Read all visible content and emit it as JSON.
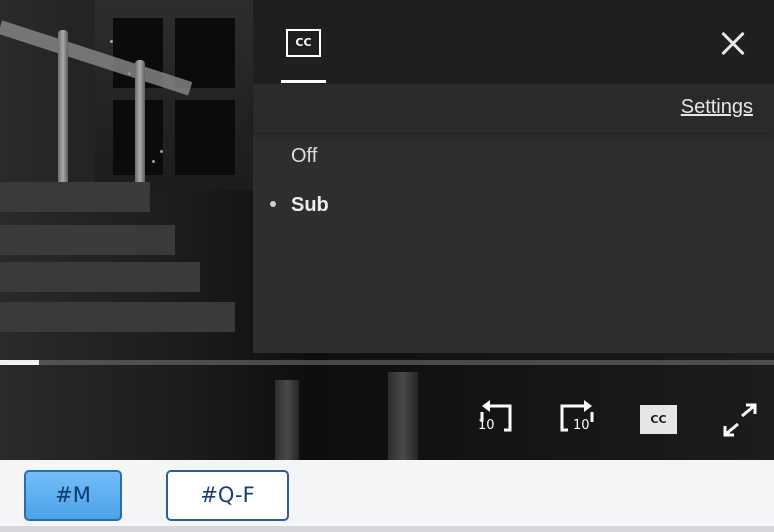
{
  "player": {
    "captions_panel": {
      "tab_label": "CC",
      "settings_link": "Settings",
      "options": [
        {
          "label": "Off",
          "selected": false
        },
        {
          "label": "Sub",
          "selected": true
        }
      ],
      "close_icon": "close-icon"
    },
    "progress": {
      "played_fraction": 0.05
    },
    "controls": {
      "rewind": {
        "icon": "rewind-10-icon",
        "seconds": "10"
      },
      "forward": {
        "icon": "forward-10-icon",
        "seconds": "10"
      },
      "captions": {
        "icon": "closed-captions-icon",
        "label": "CC"
      },
      "fullscreen": {
        "icon": "fullscreen-icon"
      }
    }
  },
  "bottom_bar": {
    "buttons": [
      {
        "label": "#M",
        "active": true
      },
      {
        "label": "#Q-F",
        "active": false
      }
    ]
  },
  "colors": {
    "panel_bg": "#2e2e2e",
    "panel_header_bg": "#1f1f1f",
    "active_button_bg": "#4aa3ea",
    "button_border": "#2d5c96"
  }
}
